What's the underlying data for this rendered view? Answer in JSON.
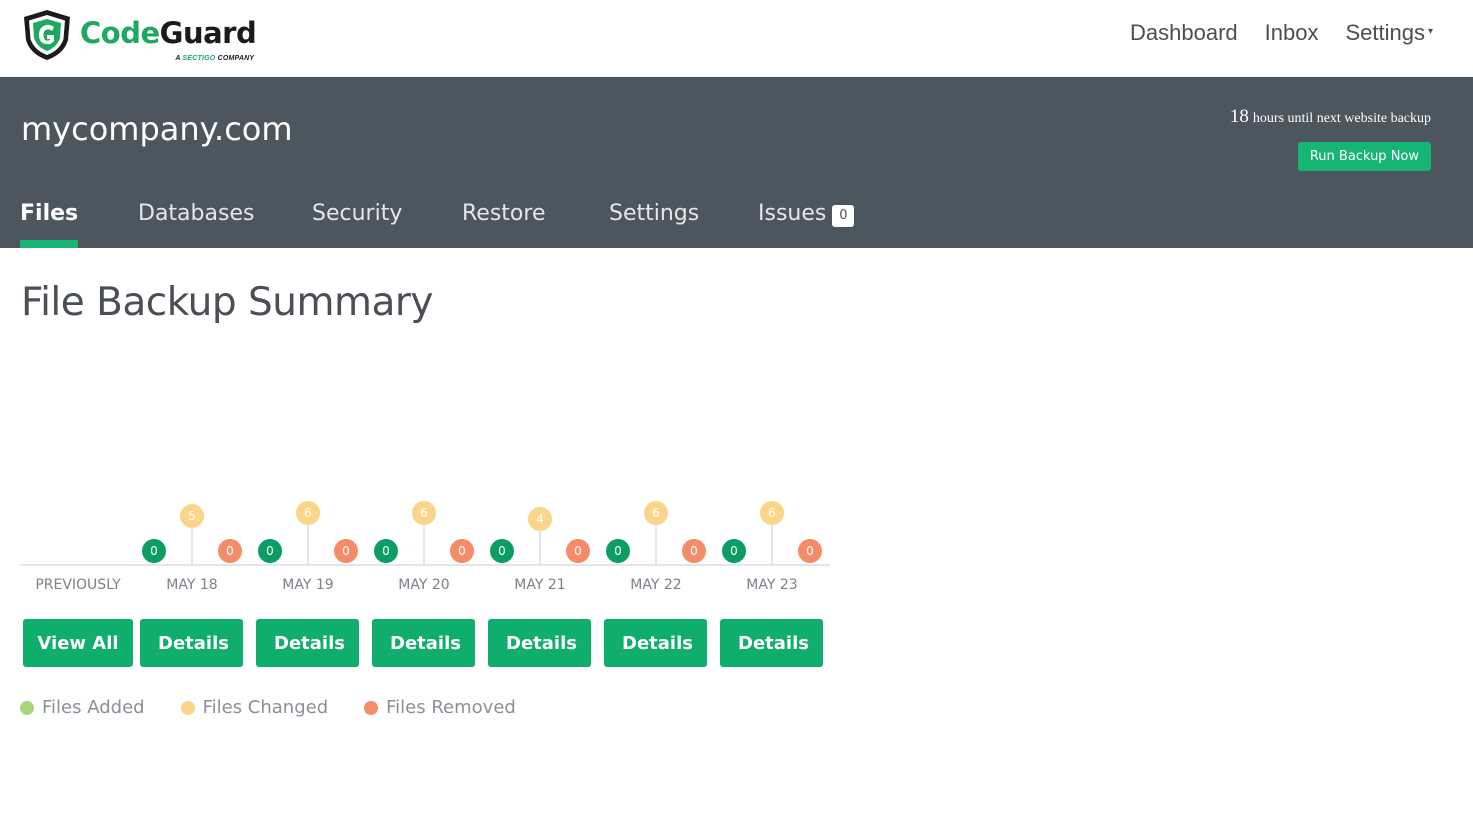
{
  "brand": {
    "name_part1": "Code",
    "name_part2": "Guard",
    "tagline_prefix": "A ",
    "tagline_brand": "SECTIGO",
    "tagline_suffix": " COMPANY",
    "green": "#1fa862"
  },
  "topnav": {
    "items": [
      {
        "label": "Dashboard"
      },
      {
        "label": "Inbox"
      },
      {
        "label": "Settings"
      }
    ],
    "caret": "▾"
  },
  "header": {
    "site": "mycompany.com",
    "countdown_hours": "18",
    "countdown_text": "hours until next website backup",
    "run_backup_label": "Run Backup Now",
    "background": "#4c565e",
    "accent": "#16b574"
  },
  "tabs": [
    {
      "label": "Files",
      "active": true
    },
    {
      "label": "Databases",
      "active": false
    },
    {
      "label": "Security",
      "active": false
    },
    {
      "label": "Restore",
      "active": false
    },
    {
      "label": "Settings",
      "active": false
    },
    {
      "label": "Issues",
      "active": false,
      "badge": "0"
    }
  ],
  "summary": {
    "title": "File Backup Summary"
  },
  "chart_data": {
    "type": "scatter",
    "categories": [
      "PREVIOUSLY",
      "MAY 18",
      "MAY 19",
      "MAY 20",
      "MAY 21",
      "MAY 22",
      "MAY 23"
    ],
    "series": [
      {
        "name": "Files Added",
        "values": [
          null,
          0,
          0,
          0,
          0,
          0,
          0
        ],
        "color": "#0a9e64"
      },
      {
        "name": "Files Changed",
        "values": [
          null,
          5,
          6,
          6,
          4,
          6,
          6
        ],
        "color": "#fbd58a"
      },
      {
        "name": "Files Removed",
        "values": [
          null,
          0,
          0,
          0,
          0,
          0,
          0
        ],
        "color": "#f58c68"
      }
    ]
  },
  "buttons": {
    "view_all": "View All",
    "details": "Details"
  },
  "legend": [
    {
      "label": "Files Added",
      "color": "#a8d67f"
    },
    {
      "label": "Files Changed",
      "color": "#fbd58a"
    },
    {
      "label": "Files Removed",
      "color": "#f58c68"
    }
  ]
}
